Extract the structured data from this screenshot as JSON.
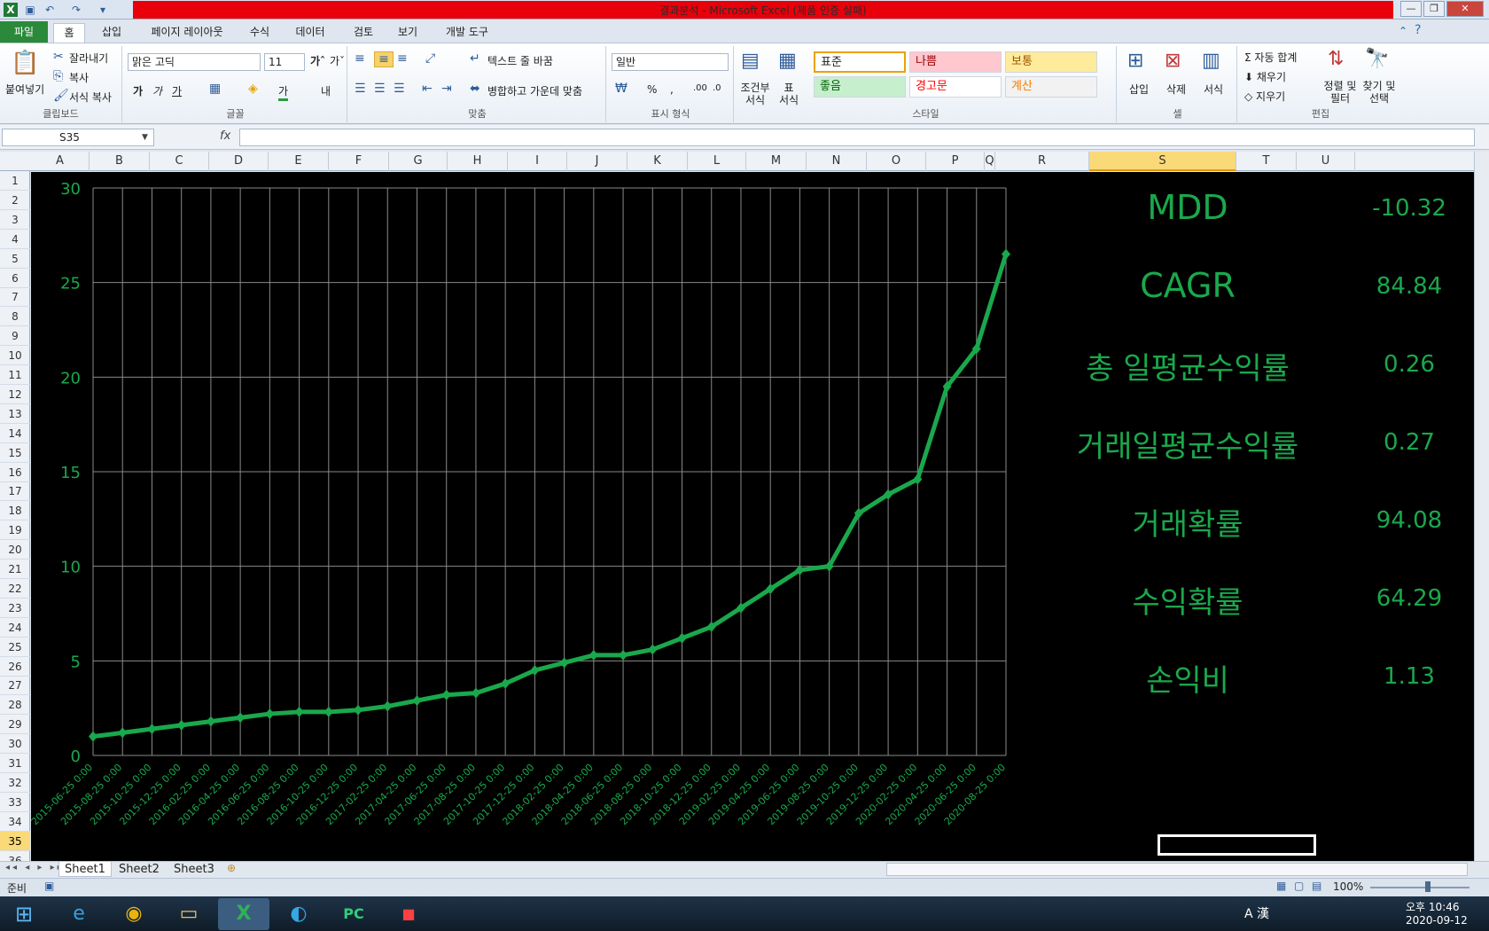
{
  "window": {
    "title": "결과분석 - Microsoft Excel (제품 인증 실패)",
    "controls": [
      "—",
      "❐",
      "✕"
    ]
  },
  "menu": {
    "file": "파일",
    "tabs": [
      "홈",
      "삽입",
      "페이지 레이아웃",
      "수식",
      "데이터",
      "검토",
      "보기",
      "개발 도구"
    ]
  },
  "ribbon": {
    "clipboard": {
      "paste": "붙여넣기",
      "cut": "잘라내기",
      "copy": "복사",
      "format_painter": "서식 복사",
      "label": "클립보드"
    },
    "font": {
      "name": "맑은 고딕",
      "size": "11",
      "label": "글꼴"
    },
    "alignment": {
      "wrap": "텍스트 줄 바꿈",
      "merge": "병합하고 가운데 맞춤",
      "label": "맞춤"
    },
    "number": {
      "format": "일반",
      "label": "표시 형식"
    },
    "styles": {
      "conditional": "조건부 서식",
      "table": "표 서식",
      "cells": [
        {
          "text": "표준",
          "bg": "#ffffff",
          "color": "#222222"
        },
        {
          "text": "나쁨",
          "bg": "#ffc7ce",
          "color": "#9c0006"
        },
        {
          "text": "보통",
          "bg": "#ffeb9c",
          "color": "#9c5700"
        },
        {
          "text": "좋음",
          "bg": "#c6efce",
          "color": "#006100"
        },
        {
          "text": "경고문",
          "bg": "#ffffff",
          "color": "#ff0000"
        },
        {
          "text": "계산",
          "bg": "#f2f2f2",
          "color": "#fa7d00"
        }
      ],
      "label": "스타일"
    },
    "cells": {
      "insert": "삽입",
      "delete": "삭제",
      "format": "서식",
      "label": "셀"
    },
    "editing": {
      "autosum": "자동 합계",
      "fill": "채우기",
      "clear": "지우기",
      "sort": "정렬 및 필터",
      "find": "찾기 및 선택",
      "label": "편집"
    }
  },
  "formula_bar": {
    "name_box": "S35",
    "fx": "fx",
    "formula": ""
  },
  "columns": [
    "A",
    "B",
    "C",
    "D",
    "E",
    "F",
    "G",
    "H",
    "I",
    "J",
    "K",
    "L",
    "M",
    "N",
    "O",
    "P",
    "Q",
    "R",
    "S",
    "T",
    "U"
  ],
  "rows": [
    "1",
    "2",
    "3",
    "4",
    "5",
    "6",
    "7",
    "8",
    "9",
    "10",
    "11",
    "12",
    "13",
    "14",
    "15",
    "16",
    "17",
    "18",
    "19",
    "20",
    "21",
    "22",
    "23",
    "24",
    "25",
    "26",
    "27",
    "28",
    "29",
    "30",
    "31",
    "32",
    "33",
    "34",
    "35",
    "36"
  ],
  "selected": {
    "column": "S",
    "row": "35"
  },
  "stats": [
    {
      "label": "MDD",
      "value": "-10.32"
    },
    {
      "label": "CAGR",
      "value": "84.84"
    },
    {
      "label": "총 일평균수익률",
      "value": "0.26"
    },
    {
      "label": "거래일평균수익률",
      "value": "0.27"
    },
    {
      "label": "거래확률",
      "value": "94.08"
    },
    {
      "label": "수익확률",
      "value": "64.29"
    },
    {
      "label": "손익비",
      "value": "1.13"
    }
  ],
  "sheets": [
    "Sheet1",
    "Sheet2",
    "Sheet3"
  ],
  "status": {
    "ready": "준비",
    "zoom": "100%"
  },
  "taskbar": {
    "time": "오후 10:46",
    "date": "2020-09-12",
    "ime": "A 漢"
  },
  "colors": {
    "chart_line": "#1aa84c",
    "chart_bg": "#000000",
    "grid": "#8a8a8a",
    "title_bar": "#e8000a",
    "file_tab": "#2a8a3a"
  },
  "chart_data": {
    "type": "line",
    "ylim": [
      0,
      30
    ],
    "yticks": [
      0,
      5,
      10,
      15,
      20,
      25,
      30
    ],
    "x_categories": [
      "2015-06-25 0:00",
      "2015-08-25 0:00",
      "2015-10-25 0:00",
      "2015-12-25 0:00",
      "2016-02-25 0:00",
      "2016-04-25 0:00",
      "2016-06-25 0:00",
      "2016-08-25 0:00",
      "2016-10-25 0:00",
      "2016-12-25 0:00",
      "2017-02-25 0:00",
      "2017-04-25 0:00",
      "2017-06-25 0:00",
      "2017-08-25 0:00",
      "2017-10-25 0:00",
      "2017-12-25 0:00",
      "2018-02-25 0:00",
      "2018-04-25 0:00",
      "2018-06-25 0:00",
      "2018-08-25 0:00",
      "2018-10-25 0:00",
      "2018-12-25 0:00",
      "2019-02-25 0:00",
      "2019-04-25 0:00",
      "2019-06-25 0:00",
      "2019-08-25 0:00",
      "2019-10-25 0:00",
      "2019-12-25 0:00",
      "2020-02-25 0:00",
      "2020-04-25 0:00",
      "2020-06-25 0:00",
      "2020-08-25 0:00"
    ],
    "series": [
      {
        "values": [
          1.0,
          1.2,
          1.4,
          1.6,
          1.8,
          2.0,
          2.2,
          2.3,
          2.3,
          2.4,
          2.6,
          2.9,
          3.2,
          3.3,
          3.8,
          4.5,
          4.9,
          5.3,
          5.3,
          5.6,
          6.2,
          6.8,
          7.8,
          8.8,
          9.8,
          10.0,
          12.8,
          13.8,
          14.6,
          19.5,
          21.5,
          26.5
        ]
      }
    ]
  }
}
